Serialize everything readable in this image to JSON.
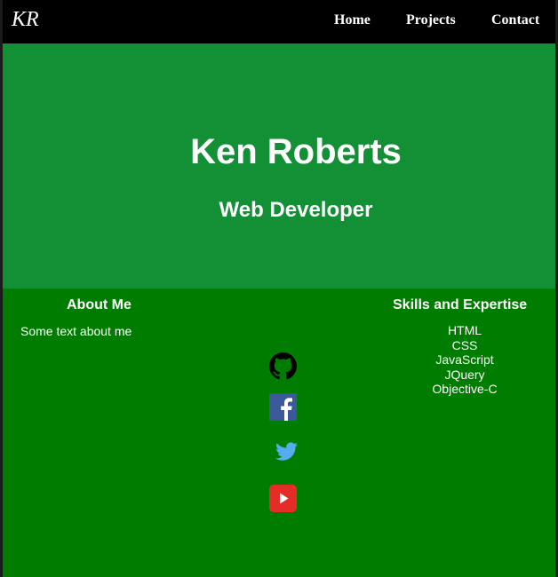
{
  "nav": {
    "brand": "KR",
    "links": [
      "Home",
      "Projects",
      "Contact"
    ]
  },
  "hero": {
    "name": "Ken Roberts",
    "role": "Web Developer"
  },
  "about": {
    "heading": "About Me",
    "text": "Some text about me"
  },
  "social": {
    "icons": [
      "github-icon",
      "facebook-icon",
      "twitter-icon",
      "youtube-icon"
    ]
  },
  "skills": {
    "heading": "Skills and Expertise",
    "items": [
      "HTML",
      "CSS",
      "JavaScript",
      "JQuery",
      "Objective-C"
    ]
  },
  "colors": {
    "navbar": "#000000",
    "hero": "#138f35",
    "content": "#007c00",
    "facebook": "#3b5998",
    "twitter": "#55acee",
    "youtube": "#e52d27"
  }
}
